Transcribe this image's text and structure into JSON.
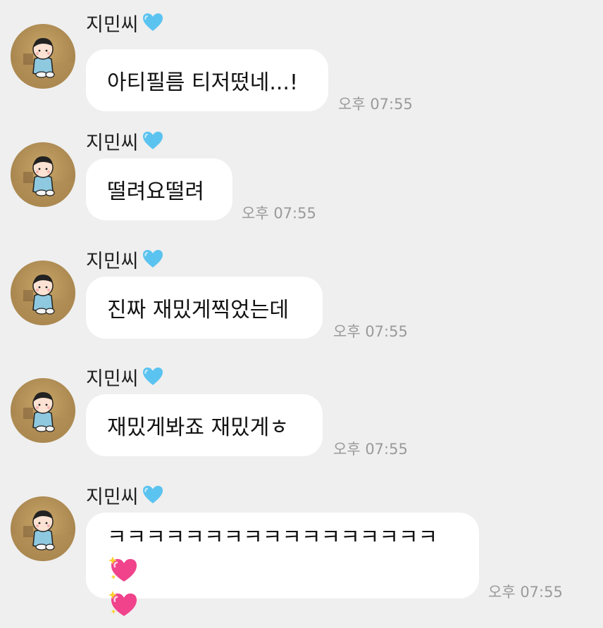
{
  "sender": {
    "name": "지민씨",
    "badge_icon": "blue-heart-icon",
    "badge_color": "#5bc3f0"
  },
  "messages": [
    {
      "text": "아티필름 티저떴네...!",
      "time": "오후 07:55"
    },
    {
      "text": "떨려요떨려",
      "time": "오후 07:55"
    },
    {
      "text": "진짜 재밌게찍었는데",
      "time": "오후 07:55"
    },
    {
      "text": "재밌게봐죠 재밌게ㅎ",
      "time": "오후 07:55"
    },
    {
      "text": "ㅋㅋㅋㅋㅋㅋㅋㅋㅋㅋㅋㅋㅋㅋㅋㅋㅋ",
      "emoji": "sparkling-heart-icon",
      "time": "오후 07:55"
    }
  ],
  "colors": {
    "background": "#efefef",
    "bubble": "#ffffff",
    "time_text": "#9a9a9a",
    "emoji_heart": "#f0438c"
  }
}
